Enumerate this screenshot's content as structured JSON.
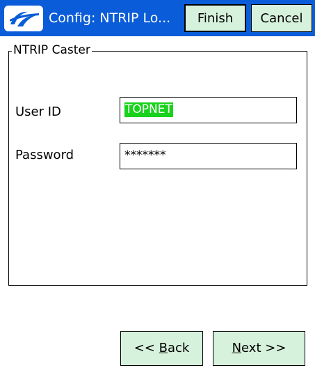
{
  "titlebar": {
    "title": "Config: NTRIP Lo...",
    "finish_label": "Finish",
    "cancel_label": "Cancel",
    "logo_icon": "app-logo-icon"
  },
  "group": {
    "title": "NTRIP Caster"
  },
  "fields": {
    "user_id_label": "User ID",
    "user_id_value": "TOPNET",
    "password_label": "Password",
    "password_value": "*******"
  },
  "nav": {
    "back_prefix": "<< ",
    "back_mnemonic": "B",
    "back_rest": "ack",
    "next_mnemonic": "N",
    "next_rest": "ext >>"
  },
  "colors": {
    "titlebar": "#0a5cd8",
    "button_bg": "#d7f2dc",
    "selection": "#19d21c"
  }
}
